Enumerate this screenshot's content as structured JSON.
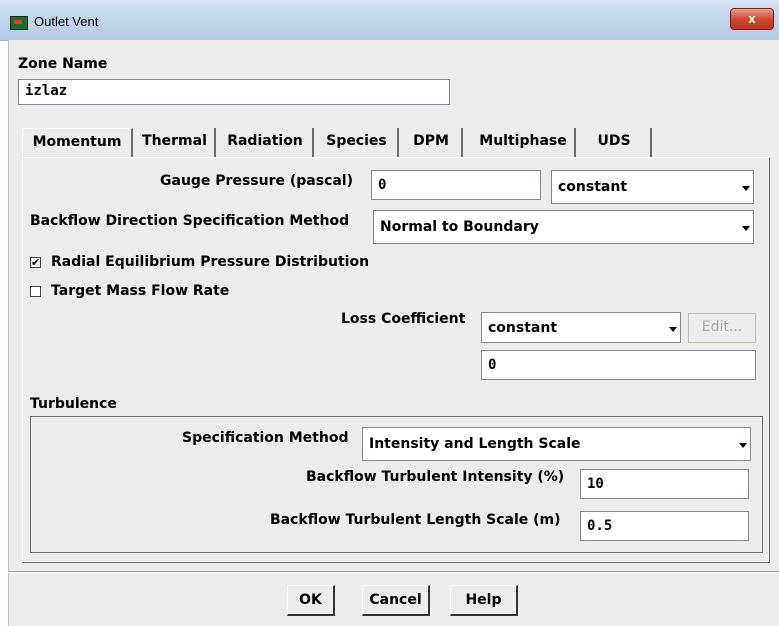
{
  "window": {
    "title": "Outlet Vent",
    "close_glyph": "x"
  },
  "zone": {
    "label": "Zone Name",
    "value": "izlaz"
  },
  "tabs": [
    {
      "label": "Momentum",
      "active": true
    },
    {
      "label": "Thermal",
      "active": false
    },
    {
      "label": "Radiation",
      "active": false
    },
    {
      "label": "Species",
      "active": false
    },
    {
      "label": "DPM",
      "active": false
    },
    {
      "label": "Multiphase",
      "active": false
    },
    {
      "label": "UDS",
      "active": false
    }
  ],
  "momentum": {
    "gauge_pressure_label": "Gauge Pressure (pascal)",
    "gauge_pressure_value": "0",
    "gauge_pressure_method": "constant",
    "backflow_label": "Backflow Direction Specification Method",
    "backflow_value": "Normal to Boundary",
    "radial_eq_label": "Radial Equilibrium Pressure Distribution",
    "radial_eq_checked": true,
    "radial_eq_mark": "✔",
    "target_mass_label": "Target Mass Flow Rate",
    "target_mass_checked": false,
    "loss_label": "Loss Coefficient",
    "loss_method": "constant",
    "loss_edit_label": "Edit...",
    "loss_value": "0"
  },
  "turbulence": {
    "section_label": "Turbulence",
    "spec_method_label": "Specification Method",
    "spec_method_value": "Intensity and Length Scale",
    "intensity_label": "Backflow Turbulent Intensity (%)",
    "intensity_value": "10",
    "length_label": "Backflow Turbulent Length Scale (m)",
    "length_value": "0.5"
  },
  "buttons": {
    "ok": "OK",
    "cancel": "Cancel",
    "help": "Help"
  }
}
